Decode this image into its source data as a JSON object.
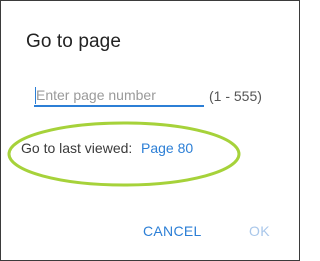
{
  "dialog": {
    "title": "Go to page",
    "input": {
      "value": "",
      "placeholder": "Enter page number"
    },
    "range_text": "(1 - 555)",
    "last_viewed": {
      "label": "Go to last viewed:",
      "link_text": "Page 80"
    },
    "buttons": {
      "cancel_label": "CANCEL",
      "ok_label": "OK",
      "ok_enabled": false
    }
  },
  "annotation": {
    "highlight_color": "#a6d23a"
  },
  "colors": {
    "accent": "#2c7fd6",
    "disabled": "#a9c7ea",
    "text": "#222222"
  }
}
